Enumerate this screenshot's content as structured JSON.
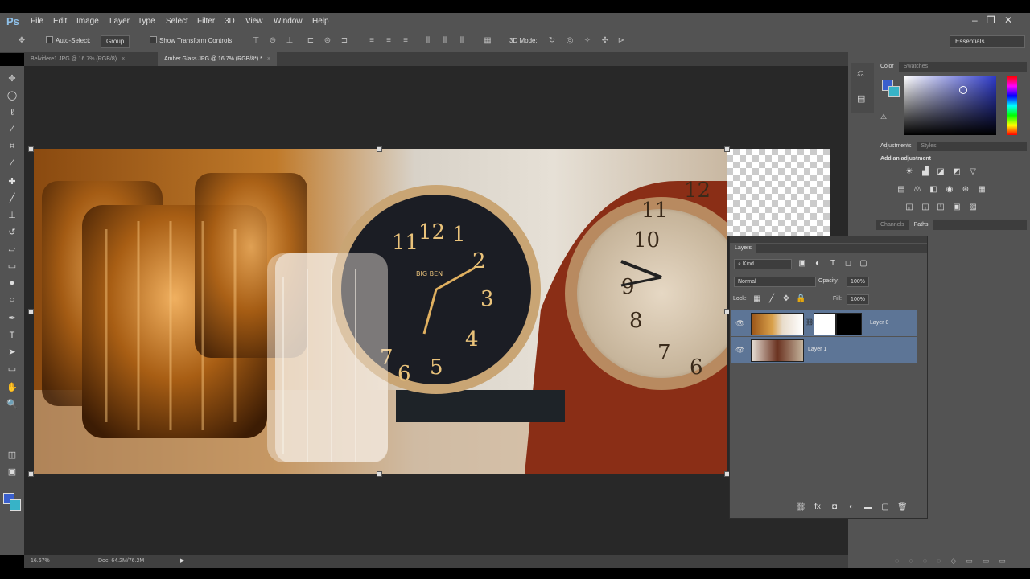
{
  "app": {
    "logo": "Ps"
  },
  "menu": {
    "items": [
      "File",
      "Edit",
      "Image",
      "Layer",
      "Type",
      "Select",
      "Filter",
      "3D",
      "View",
      "Window",
      "Help"
    ]
  },
  "window_controls": [
    "–",
    "❐",
    "✕"
  ],
  "options": {
    "auto_select_label": "Auto-Select:",
    "auto_select_value": "Group",
    "transform_label": "Show Transform Controls",
    "mode3d_label": "3D Mode:",
    "workspace": "Essentials"
  },
  "tabs": [
    {
      "label": "Belvidere1.JPG @ 16.7% (RGB/8)"
    },
    {
      "label": "Amber Glass.JPG @ 16.7% (RGB/8*) *"
    }
  ],
  "status": {
    "zoom": "16.67%",
    "doc": "Doc: 64.2M/76.2M"
  },
  "color_panel": {
    "tabs": [
      "Color",
      "Swatches"
    ],
    "fg": "#3a5fcd",
    "bg": "#37b3c7"
  },
  "adjustments_panel": {
    "tabs": [
      "Adjustments",
      "Styles"
    ],
    "heading": "Add an adjustment"
  },
  "channels_panel": {
    "tabs": [
      "Channels",
      "Paths"
    ]
  },
  "layers_panel": {
    "title": "Layers",
    "filter_kind": "Kind",
    "blend_mode": "Normal",
    "opacity_label": "Opacity:",
    "opacity_value": "100%",
    "lock_label": "Lock:",
    "fill_label": "Fill:",
    "fill_value": "100%",
    "layers": [
      {
        "name": "Layer 0",
        "has_mask": true
      },
      {
        "name": "Layer 1",
        "has_mask": false
      }
    ]
  }
}
